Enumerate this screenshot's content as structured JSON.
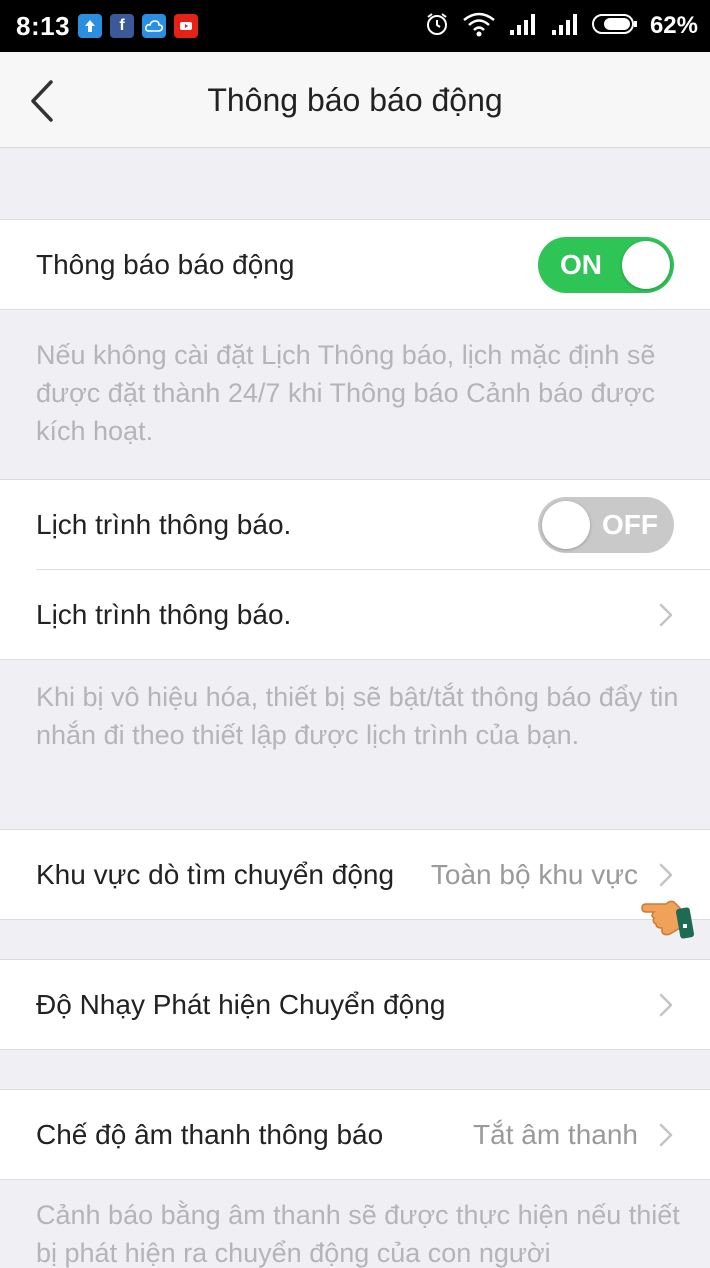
{
  "status_bar": {
    "time": "8:13",
    "battery_percent": "62%",
    "notification_icons": [
      "upload-icon",
      "facebook-icon",
      "cloud-icon",
      "youtube-icon"
    ],
    "system_icons": [
      "alarm-icon",
      "wifi-icon",
      "signal-icon",
      "signal-icon",
      "battery-icon"
    ]
  },
  "header": {
    "title": "Thông báo báo động"
  },
  "alarm_notification": {
    "label": "Thông báo báo động",
    "toggle_text": "ON",
    "enabled": true
  },
  "alarm_description": "Nếu không cài đặt Lịch Thông báo, lịch mặc định sẽ được đặt thành 24/7 khi Thông báo Cảnh báo được kích hoạt.",
  "schedule_toggle": {
    "label": "Lịch trình thông báo.",
    "toggle_text": "OFF",
    "enabled": false
  },
  "schedule_link": {
    "label": "Lịch trình thông báo."
  },
  "schedule_description": "Khi bị vô hiệu hóa, thiết bị sẽ bật/tắt thông báo đẩy tin nhắn đi theo thiết lập được lịch trình của bạn.",
  "motion_area": {
    "label": "Khu vực dò tìm chuyển động",
    "value": "Toàn bộ khu vực"
  },
  "motion_sensitivity": {
    "label": "Độ Nhạy Phát hiện Chuyển động"
  },
  "sound_mode": {
    "label": "Chế độ âm thanh thông báo",
    "value": "Tắt âm thanh"
  },
  "sound_description": "Cảnh báo bằng âm thanh sẽ được thực hiện nếu thiết bị phát hiện ra chuyển động của con người",
  "colors": {
    "toggle_on": "#2ec456",
    "toggle_off": "#c9c9c9",
    "background": "#efeff4",
    "secondary_text": "#9a9a9a"
  }
}
